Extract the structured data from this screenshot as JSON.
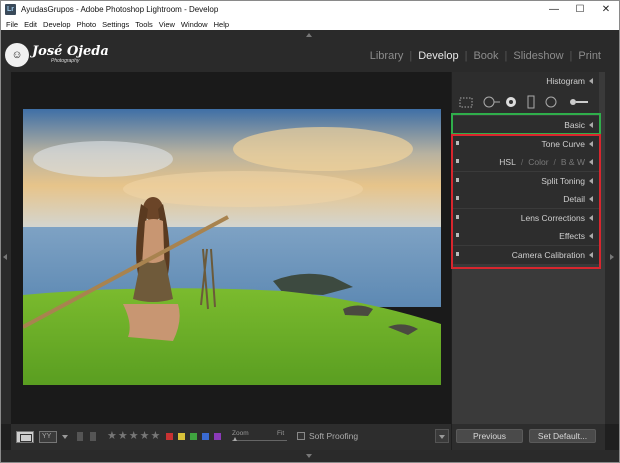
{
  "window": {
    "title": "AyudasGrupos - Adobe Photoshop Lightroom - Develop",
    "app_icon": "Lr",
    "controls": {
      "minimize": "—",
      "maximize": "☐",
      "close": "✕"
    }
  },
  "menu": [
    "File",
    "Edit",
    "Develop",
    "Photo",
    "Settings",
    "Tools",
    "View",
    "Window",
    "Help"
  ],
  "identity_plate": {
    "name": "José Ojeda",
    "sub": "Photography",
    "icon": "person-face-icon"
  },
  "modules": [
    {
      "label": "Library",
      "active": false
    },
    {
      "label": "Develop",
      "active": true
    },
    {
      "label": "Book",
      "active": false
    },
    {
      "label": "Slideshow",
      "active": false
    },
    {
      "label": "Print",
      "active": false
    }
  ],
  "right_panel": {
    "histogram": "Histogram",
    "basic": "Basic",
    "tone_curve": "Tone Curve",
    "hsl": {
      "hsl": "HSL",
      "sep": "/",
      "color": "Color",
      "bw": "B & W"
    },
    "split_toning": "Split Toning",
    "detail": "Detail",
    "lens_corrections": "Lens Corrections",
    "effects": "Effects",
    "camera_calibration": "Camera Calibration",
    "previous_button": "Previous",
    "set_default_button": "Set Default..."
  },
  "toolbar": {
    "stars": "★★★★★",
    "zoom_label": "Zoom",
    "fit_label": "Fit",
    "soft_proofing_label": "Soft Proofing",
    "color_labels": [
      "#c83232",
      "#d8c23a",
      "#3fa33f",
      "#3a6ad0",
      "#8a3ab8"
    ]
  },
  "highlights": {
    "green": "#2fae4b",
    "red": "#d8262e"
  }
}
